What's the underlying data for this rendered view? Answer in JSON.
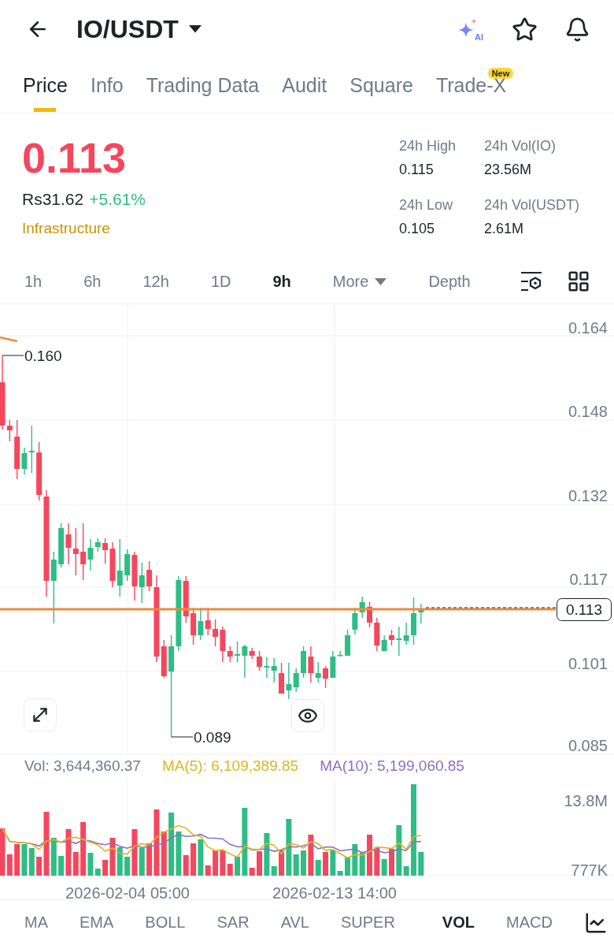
{
  "header": {
    "title": "IO/USDT",
    "ai_label": "AI"
  },
  "tabs": [
    {
      "label": "Price",
      "selected": true
    },
    {
      "label": "Info",
      "selected": false
    },
    {
      "label": "Trading Data",
      "selected": false
    },
    {
      "label": "Audit",
      "selected": false
    },
    {
      "label": "Square",
      "selected": false
    },
    {
      "label": "Trade-X",
      "selected": false,
      "badge": "New"
    }
  ],
  "ticker": {
    "price": "0.113",
    "fiat": "Rs31.62",
    "change": "+5.61%",
    "category": "Infrastructure",
    "stats": [
      {
        "label": "24h High",
        "value": "0.115"
      },
      {
        "label": "24h Vol(IO)",
        "value": "23.56M"
      },
      {
        "label": "24h Low",
        "value": "0.105"
      },
      {
        "label": "24h Vol(USDT)",
        "value": "2.61M"
      }
    ]
  },
  "intervals": [
    {
      "label": "1h",
      "selected": false,
      "kind": "option"
    },
    {
      "label": "6h",
      "selected": false,
      "kind": "option"
    },
    {
      "label": "12h",
      "selected": false,
      "kind": "option"
    },
    {
      "label": "1D",
      "selected": false,
      "kind": "option"
    },
    {
      "label": "9h",
      "selected": true,
      "kind": "option"
    },
    {
      "label": "More",
      "selected": false,
      "kind": "menu"
    },
    {
      "label": "Depth",
      "selected": false,
      "kind": "option"
    }
  ],
  "price_chart": {
    "y_ticks": [
      "0.164",
      "0.148",
      "0.132",
      "0.117",
      "0.101",
      "0.085"
    ],
    "high_label": "0.160",
    "low_label": "0.089",
    "last_price": "0.113"
  },
  "volume_chart": {
    "legend": [
      {
        "text": "Vol: 3,644,360.37",
        "color": "#707a8a"
      },
      {
        "text": "MA(5): 6,109,389.85",
        "color": "#e0b320"
      },
      {
        "text": "MA(10): 5,199,060.85",
        "color": "#8a6fc4"
      }
    ],
    "y_ticks": [
      "13.8M",
      "777K"
    ],
    "x_labels": [
      "2026-02-04 05:00",
      "2026-02-13 14:00"
    ]
  },
  "indicators": {
    "main": [
      {
        "label": "MA",
        "selected": false
      },
      {
        "label": "EMA",
        "selected": false
      },
      {
        "label": "BOLL",
        "selected": false
      },
      {
        "label": "SAR",
        "selected": false
      },
      {
        "label": "AVL",
        "selected": false
      },
      {
        "label": "SUPER",
        "selected": false
      }
    ],
    "sub": [
      {
        "label": "VOL",
        "selected": true
      },
      {
        "label": "MACD",
        "selected": false
      }
    ]
  }
}
